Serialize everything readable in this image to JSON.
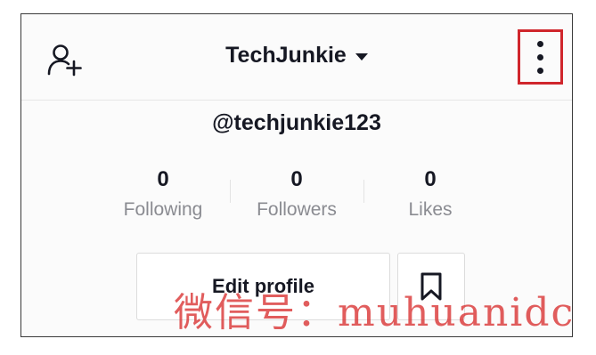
{
  "header": {
    "title": "TechJunkie",
    "icons": {
      "add_user": "add-user-icon",
      "dropdown": "caret-down-icon",
      "menu": "more-vertical-icon"
    }
  },
  "profile": {
    "username": "@techjunkie123"
  },
  "stats": [
    {
      "value": "0",
      "label": "Following"
    },
    {
      "value": "0",
      "label": "Followers"
    },
    {
      "value": "0",
      "label": "Likes"
    }
  ],
  "actions": {
    "edit_profile": "Edit profile",
    "bookmark_icon": "bookmark-icon"
  },
  "colors": {
    "highlight": "#d0262c",
    "text": "#161823",
    "muted": "#8a8b91",
    "watermark": "#d83030"
  },
  "watermark": {
    "text": "微信号：muhuanidc"
  }
}
